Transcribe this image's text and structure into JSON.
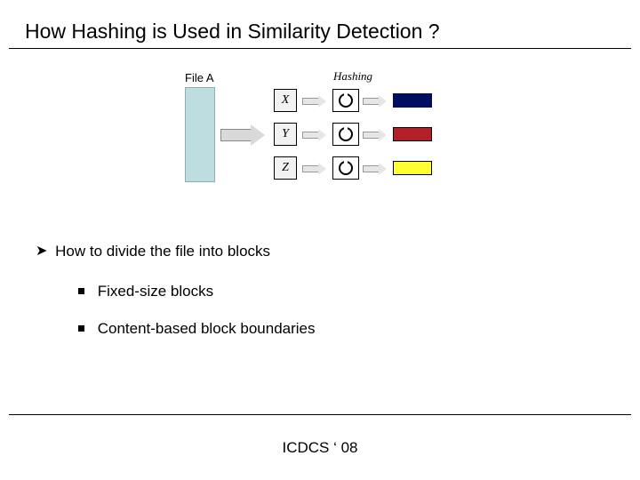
{
  "title": "How Hashing is Used in Similarity Detection ?",
  "diagram": {
    "file_label": "File A",
    "hashing_label": "Hashing",
    "blocks": {
      "x": "X",
      "y": "Y",
      "z": "Z"
    },
    "output_colors": {
      "a": "#000d5e",
      "b": "#b4202a",
      "c": "#ffff33"
    }
  },
  "bullets": {
    "main": "How to divide the file into blocks",
    "sub1": "Fixed-size blocks",
    "sub2": "Content-based block boundaries"
  },
  "footer": "ICDCS ‘ 08"
}
